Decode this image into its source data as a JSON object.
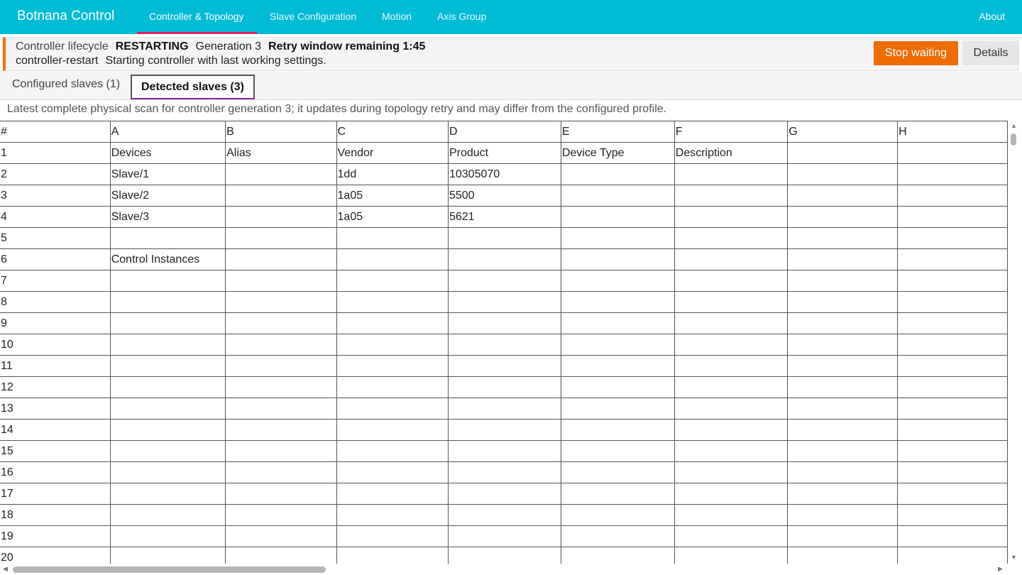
{
  "app": {
    "title": "Botnana Control"
  },
  "nav": {
    "tabs": [
      {
        "label": "Controller & Topology"
      },
      {
        "label": "Slave Configuration"
      },
      {
        "label": "Motion"
      },
      {
        "label": "Axis Group"
      }
    ],
    "about": "About"
  },
  "lifecycle": {
    "label": "Controller lifecycle",
    "state": "RESTARTING",
    "generation": "Generation 3",
    "retry": "Retry window remaining 1:45",
    "event": "controller-restart",
    "message": "Starting controller with last working settings.",
    "stop_button": "Stop waiting",
    "details_button": "Details",
    "accent_color": "#ef6c00"
  },
  "subtabs": [
    {
      "label": "Configured slaves (1)"
    },
    {
      "label": "Detected slaves (3)"
    }
  ],
  "scan_note": "Latest complete physical scan for controller generation 3; it updates during topology retry and may differ from the configured profile.",
  "grid": {
    "columns": [
      "#",
      "A",
      "B",
      "C",
      "D",
      "E",
      "F",
      "G",
      "H"
    ],
    "rows": [
      [
        "1",
        "Devices",
        "Alias",
        "Vendor",
        "Product",
        "Device Type",
        "Description",
        "",
        ""
      ],
      [
        "2",
        "Slave/1",
        "",
        "1dd",
        "10305070",
        "",
        "",
        "",
        ""
      ],
      [
        "3",
        "Slave/2",
        "",
        "1a05",
        "5500",
        "",
        "",
        "",
        ""
      ],
      [
        "4",
        "Slave/3",
        "",
        "1a05",
        "5621",
        "",
        "",
        "",
        ""
      ],
      [
        "5",
        "",
        "",
        "",
        "",
        "",
        "",
        "",
        ""
      ],
      [
        "6",
        "Control Instances",
        "",
        "",
        "",
        "",
        "",
        "",
        ""
      ],
      [
        "7",
        "",
        "",
        "",
        "",
        "",
        "",
        "",
        ""
      ],
      [
        "8",
        "",
        "",
        "",
        "",
        "",
        "",
        "",
        ""
      ],
      [
        "9",
        "",
        "",
        "",
        "",
        "",
        "",
        "",
        ""
      ],
      [
        "10",
        "",
        "",
        "",
        "",
        "",
        "",
        "",
        ""
      ],
      [
        "11",
        "",
        "",
        "",
        "",
        "",
        "",
        "",
        ""
      ],
      [
        "12",
        "",
        "",
        "",
        "",
        "",
        "",
        "",
        ""
      ],
      [
        "13",
        "",
        "",
        "",
        "",
        "",
        "",
        "",
        ""
      ],
      [
        "14",
        "",
        "",
        "",
        "",
        "",
        "",
        "",
        ""
      ],
      [
        "15",
        "",
        "",
        "",
        "",
        "",
        "",
        "",
        ""
      ],
      [
        "16",
        "",
        "",
        "",
        "",
        "",
        "",
        "",
        ""
      ],
      [
        "17",
        "",
        "",
        "",
        "",
        "",
        "",
        "",
        ""
      ],
      [
        "18",
        "",
        "",
        "",
        "",
        "",
        "",
        "",
        ""
      ],
      [
        "19",
        "",
        "",
        "",
        "",
        "",
        "",
        "",
        ""
      ],
      [
        "20",
        "",
        "",
        "",
        "",
        "",
        "",
        "",
        ""
      ]
    ]
  },
  "colors": {
    "header_bar": "#00bcd4",
    "active_nav_underline": "#e91e63",
    "stop_button": "#ef6c00"
  }
}
